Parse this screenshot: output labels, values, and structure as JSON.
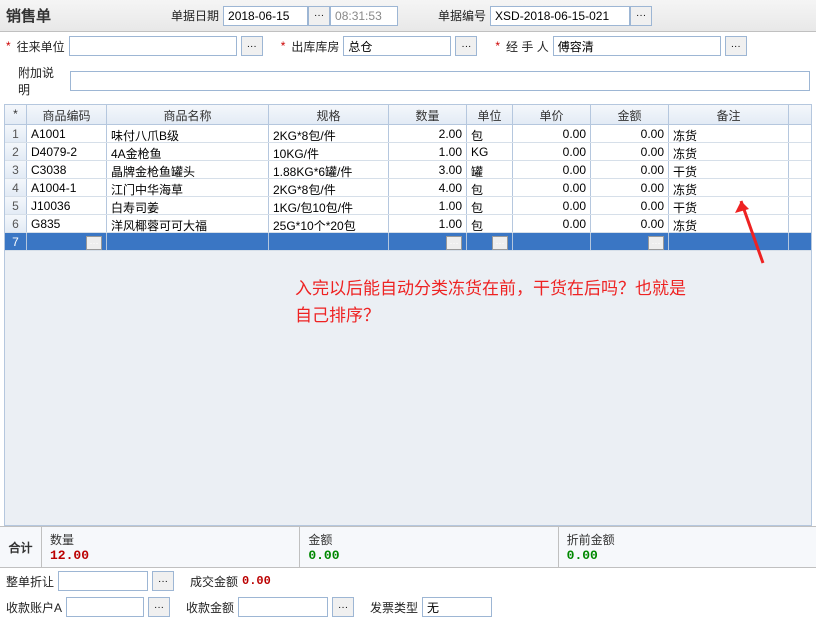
{
  "header": {
    "title": "销售单",
    "date_label": "单据日期",
    "date_value": "2018-06-15",
    "time_value": "08:31:53",
    "docno_label": "单据编号",
    "docno_value": "XSD-2018-06-15-021"
  },
  "form": {
    "partner_label": "往来单位",
    "partner_value": "",
    "warehouse_label": "出库库房",
    "warehouse_value": "总仓",
    "handler_label": "经 手 人",
    "handler_value": "傅容清",
    "notes_label": "附加说明",
    "notes_value": ""
  },
  "grid": {
    "columns": {
      "star": "*",
      "code": "商品编码",
      "name": "商品名称",
      "spec": "规格",
      "qty": "数量",
      "unit": "单位",
      "price": "单价",
      "amount": "金额",
      "remark": "备注"
    },
    "rows": [
      {
        "n": "1",
        "code": "A1001",
        "name": "味付八爪B级",
        "spec": "2KG*8包/件",
        "qty": "2.00",
        "unit": "包",
        "price": "0.00",
        "amount": "0.00",
        "remark": "冻货"
      },
      {
        "n": "2",
        "code": "D4079-2",
        "name": "4A金枪鱼",
        "spec": "10KG/件",
        "qty": "1.00",
        "unit": "KG",
        "price": "0.00",
        "amount": "0.00",
        "remark": "冻货"
      },
      {
        "n": "3",
        "code": "C3038",
        "name": "晶牌金枪鱼罐头",
        "spec": "1.88KG*6罐/件",
        "qty": "3.00",
        "unit": "罐",
        "price": "0.00",
        "amount": "0.00",
        "remark": "干货"
      },
      {
        "n": "4",
        "code": "A1004-1",
        "name": "江门中华海草",
        "spec": "2KG*8包/件",
        "qty": "4.00",
        "unit": "包",
        "price": "0.00",
        "amount": "0.00",
        "remark": "冻货"
      },
      {
        "n": "5",
        "code": "J10036",
        "name": "白寿司姜",
        "spec": "1KG/包10包/件",
        "qty": "1.00",
        "unit": "包",
        "price": "0.00",
        "amount": "0.00",
        "remark": "干货"
      },
      {
        "n": "6",
        "code": "G835",
        "name": "洋风椰蓉可可大福",
        "spec": "25G*10个*20包",
        "qty": "1.00",
        "unit": "包",
        "price": "0.00",
        "amount": "0.00",
        "remark": "冻货"
      }
    ],
    "empty_row_n": "7"
  },
  "annotation": {
    "line1": "入完以后能自动分类冻货在前，干货在后吗？也就是",
    "line2": "自己排序？"
  },
  "summary": {
    "total_label": "合计",
    "qty_label": "数量",
    "qty_value": "12.00",
    "amount_label": "金额",
    "amount_value": "0.00",
    "prediscount_label": "折前金额",
    "prediscount_value": "0.00"
  },
  "bottom": {
    "discount_label": "整单折让",
    "discount_value": "",
    "deal_amount_label": "成交金额",
    "deal_amount_value": "0.00",
    "receipt_account_label": "收款账户A",
    "receipt_account_value": "",
    "receipt_amount_label": "收款金额",
    "receipt_amount_value": "",
    "invoice_type_label": "发票类型",
    "invoice_type_value": "无"
  },
  "ellipsis": "···"
}
